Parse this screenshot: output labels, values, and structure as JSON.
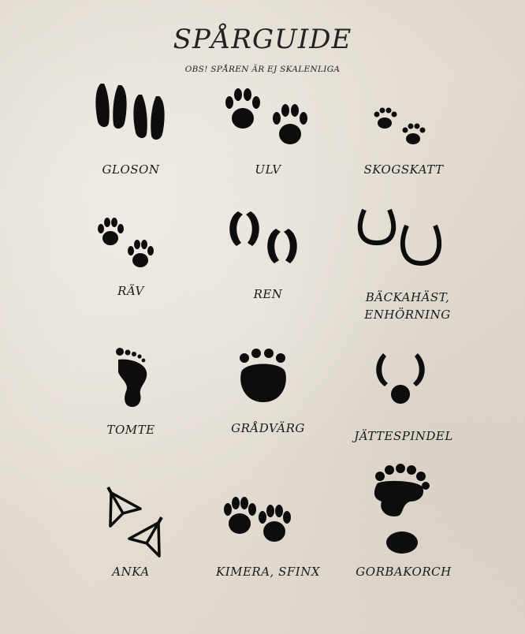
{
  "header": {
    "title": "SPÅRGUIDE",
    "subtitle": "OBS! SPÅREN ÄR EJ SKALENLIGA"
  },
  "tracks": [
    {
      "label": "GLOSON",
      "icon": "cloven-hoof-icon"
    },
    {
      "label": "ULV",
      "icon": "wolf-paw-icon"
    },
    {
      "label": "SKOGSKATT",
      "icon": "cat-paw-icon"
    },
    {
      "label": "RÄV",
      "icon": "fox-paw-icon"
    },
    {
      "label": "REN",
      "icon": "reindeer-hoof-icon"
    },
    {
      "label": "BÄCKAHÄST, ENHÖRNING",
      "icon": "horseshoe-icon"
    },
    {
      "label": "TOMTE",
      "icon": "foot-icon"
    },
    {
      "label": "GRÅDVÄRG",
      "icon": "bear-paw-icon"
    },
    {
      "label": "JÄTTESPINDEL",
      "icon": "spider-track-icon"
    },
    {
      "label": "ANKA",
      "icon": "webbed-foot-icon"
    },
    {
      "label": "KIMERA, SFINX",
      "icon": "lion-paw-icon"
    },
    {
      "label": "GORBAKORCH",
      "icon": "claw-foot-icon"
    }
  ]
}
